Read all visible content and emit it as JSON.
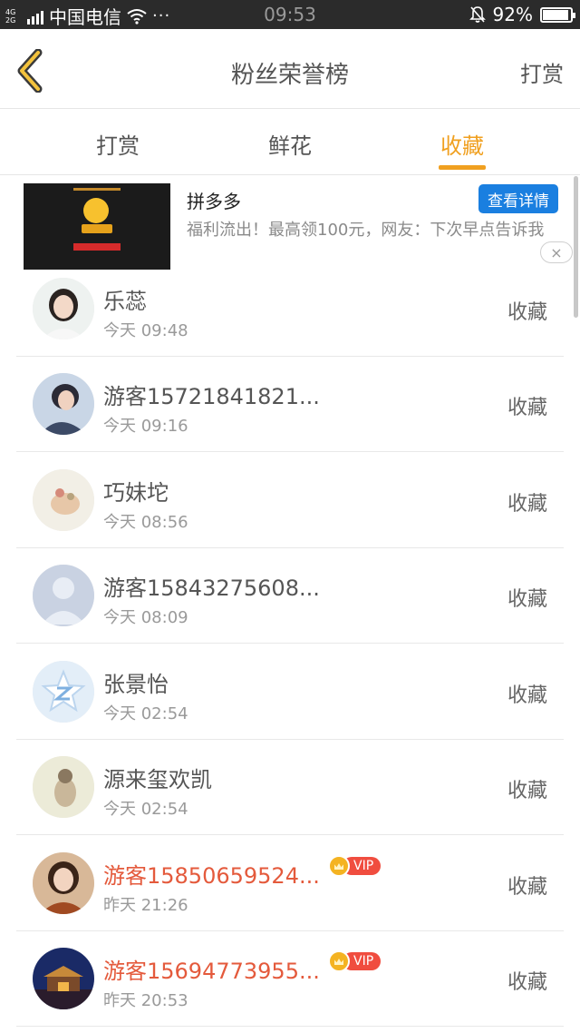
{
  "status_bar": {
    "network_top": "4G",
    "network_bottom": "2G",
    "carrier": "中国电信",
    "dots": "···",
    "time": "09:53",
    "battery": "92%",
    "battery_level": 0.92
  },
  "header": {
    "title": "粉丝荣誉榜",
    "action_label": "打赏"
  },
  "tabs": [
    {
      "label": "打赏",
      "active": false
    },
    {
      "label": "鲜花",
      "active": false
    },
    {
      "label": "收藏",
      "active": true
    }
  ],
  "ad": {
    "title": "拼多多",
    "description": "福利流出！最高领100元，网友：下次早点告诉我",
    "button_label": "查看详情",
    "close_glyph": "×"
  },
  "list": [
    {
      "name": "乐蕊",
      "time": "今天 09:48",
      "action": "收藏",
      "vip": false,
      "avatar": "girl-photo"
    },
    {
      "name": "游客15721841821...",
      "time": "今天 09:16",
      "action": "收藏",
      "vip": false,
      "avatar": "boy-photo"
    },
    {
      "name": "巧妹坨",
      "time": "今天 08:56",
      "action": "收藏",
      "vip": false,
      "avatar": "illustration"
    },
    {
      "name": "游客15843275608...",
      "time": "今天 08:09",
      "action": "收藏",
      "vip": false,
      "avatar": "default-person"
    },
    {
      "name": "张景怡",
      "time": "今天 02:54",
      "action": "收藏",
      "vip": false,
      "avatar": "qq-star"
    },
    {
      "name": "源来玺欢凯",
      "time": "今天 02:54",
      "action": "收藏",
      "vip": false,
      "avatar": "illustration-2"
    },
    {
      "name": "游客15850659524...",
      "time": "昨天 21:26",
      "action": "收藏",
      "vip": true,
      "vip_label": "VIP",
      "avatar": "woman-photo"
    },
    {
      "name": "游客15694773955...",
      "time": "昨天 20:53",
      "action": "收藏",
      "vip": true,
      "vip_label": "VIP",
      "avatar": "night-city"
    }
  ],
  "colors": {
    "accent": "#f0a020",
    "vip_name": "#e45a3c",
    "ad_button": "#1a7fe0"
  }
}
